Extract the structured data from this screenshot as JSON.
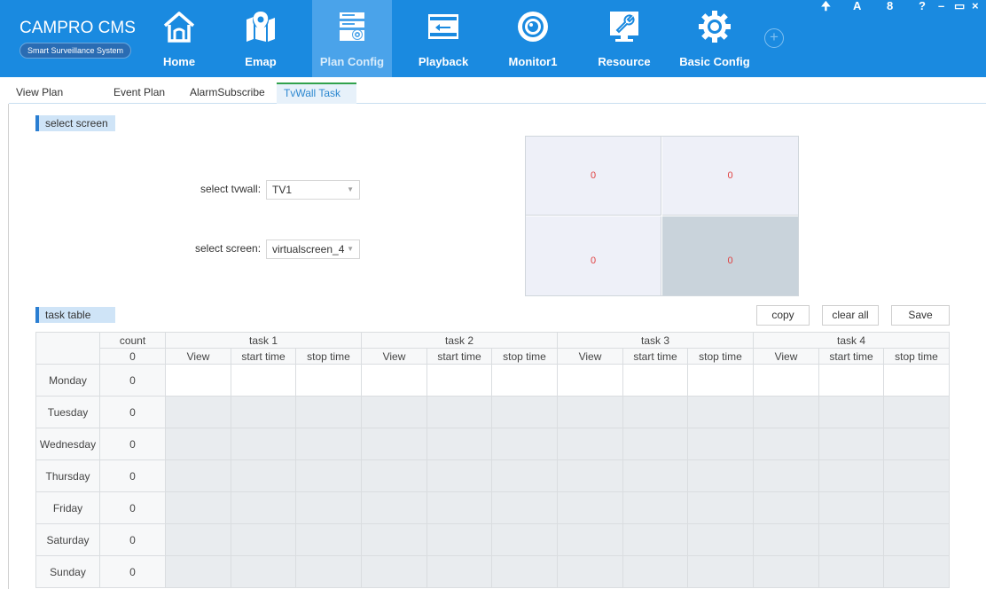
{
  "app": {
    "title": "CAMPRO CMS",
    "subtitle": "Smart Surveillance System"
  },
  "nav": [
    {
      "label": "Home",
      "icon": "house-icon"
    },
    {
      "label": "Emap",
      "icon": "map-pin-icon"
    },
    {
      "label": "Plan Config",
      "icon": "plan-config-icon",
      "active": true
    },
    {
      "label": "Playback",
      "icon": "playback-icon"
    },
    {
      "label": "Monitor1",
      "icon": "camera-lens-icon"
    },
    {
      "label": "Resource",
      "icon": "wrench-monitor-icon"
    },
    {
      "label": "Basic Config",
      "icon": "gear-icon"
    }
  ],
  "window_controls": {
    "pin": "🠉",
    "language": "A",
    "lock": "8",
    "help": "?",
    "minimize": "–",
    "maximize": "▭",
    "close": "×"
  },
  "tabs": [
    {
      "label": "View Plan"
    },
    {
      "label": "Event Plan"
    },
    {
      "label": "AlarmSubscribe"
    },
    {
      "label": "TvWall Task",
      "active": true
    }
  ],
  "select_screen": {
    "section_label": "select screen",
    "tvwall_label": "select tvwall:",
    "tvwall_value": "TV1",
    "screen_label": "select screen:",
    "screen_value": "virtualscreen_4",
    "cells": [
      "0",
      "0",
      "0",
      "0"
    ],
    "selected_cell": 3
  },
  "task_table": {
    "section_label": "task table",
    "buttons": {
      "copy": "copy",
      "clear_all": "clear all",
      "save": "Save"
    },
    "count_header": "count",
    "count_total": "0",
    "tasks": [
      "task 1",
      "task 2",
      "task 3",
      "task 4"
    ],
    "sub_headers": [
      "View",
      "start time",
      "stop time"
    ],
    "days": [
      {
        "day": "Monday",
        "count": "0"
      },
      {
        "day": "Tuesday",
        "count": "0"
      },
      {
        "day": "Wednesday",
        "count": "0"
      },
      {
        "day": "Thursday",
        "count": "0"
      },
      {
        "day": "Friday",
        "count": "0"
      },
      {
        "day": "Saturday",
        "count": "0"
      },
      {
        "day": "Sunday",
        "count": "0"
      }
    ]
  },
  "colors": {
    "header_bg": "#1a8ae0",
    "active_nav_bg": "#4aa3ea",
    "active_tab_accent": "#31a24c",
    "cell_value": "#e04040"
  }
}
